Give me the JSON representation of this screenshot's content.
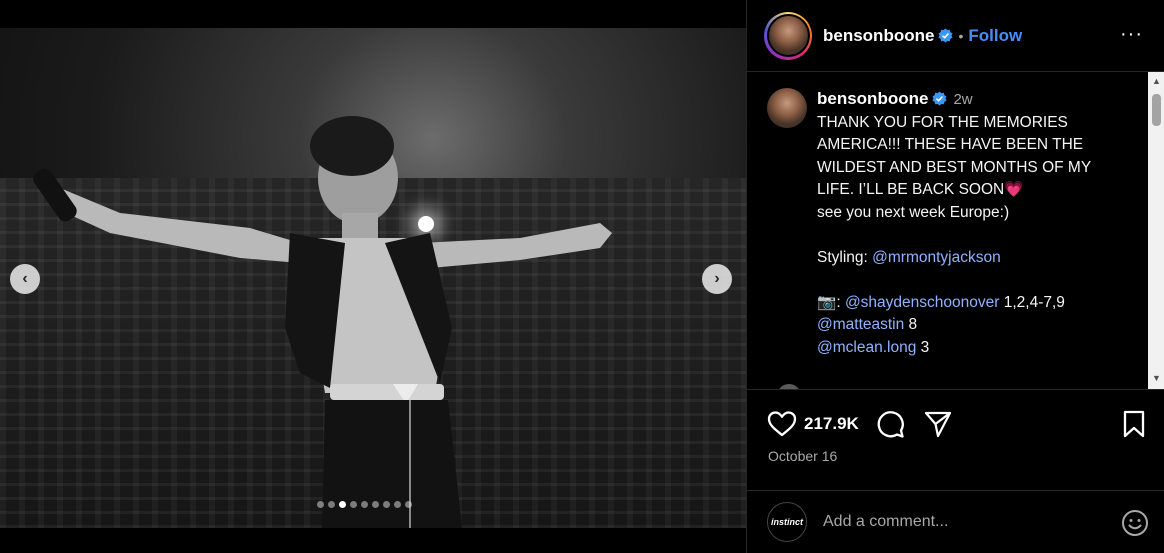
{
  "media": {
    "prev_icon": "chevron-left-icon",
    "next_icon": "chevron-right-icon",
    "slide_count": 9,
    "active_slide": 3
  },
  "header": {
    "username": "bensonboone",
    "separator": "•",
    "follow_label": "Follow",
    "more_label": "···"
  },
  "caption": {
    "username": "bensonboone",
    "time": "2w",
    "lines": [
      "THANK YOU FOR THE MEMORIES AMERICA!!! THESE HAVE BEEN THE WILDEST AND BEST MONTHS OF MY LIFE. I’LL BE BACK SOON",
      "see you next week Europe:)"
    ],
    "heart_emoji": "💗",
    "styling_label": "Styling: ",
    "styling_mention": "@mrmontyjackson",
    "camera_emoji": "📷",
    "camera_sep": ": ",
    "credits": [
      {
        "mention": "@shaydenschoonover",
        "detail": " 1,2,4-7,9"
      },
      {
        "mention": "@matteastin",
        "detail": " 8"
      },
      {
        "mention": "@mclean.long",
        "detail": " 3"
      }
    ]
  },
  "actions": {
    "likes": "217.9K",
    "date": "October 16"
  },
  "add_comment": {
    "avatar_text": "instinct",
    "placeholder": "Add a comment..."
  },
  "colors": {
    "link": "#4a8cf7",
    "mention": "#8fb3ff",
    "muted": "#a8a8a8",
    "divider": "#262626"
  }
}
